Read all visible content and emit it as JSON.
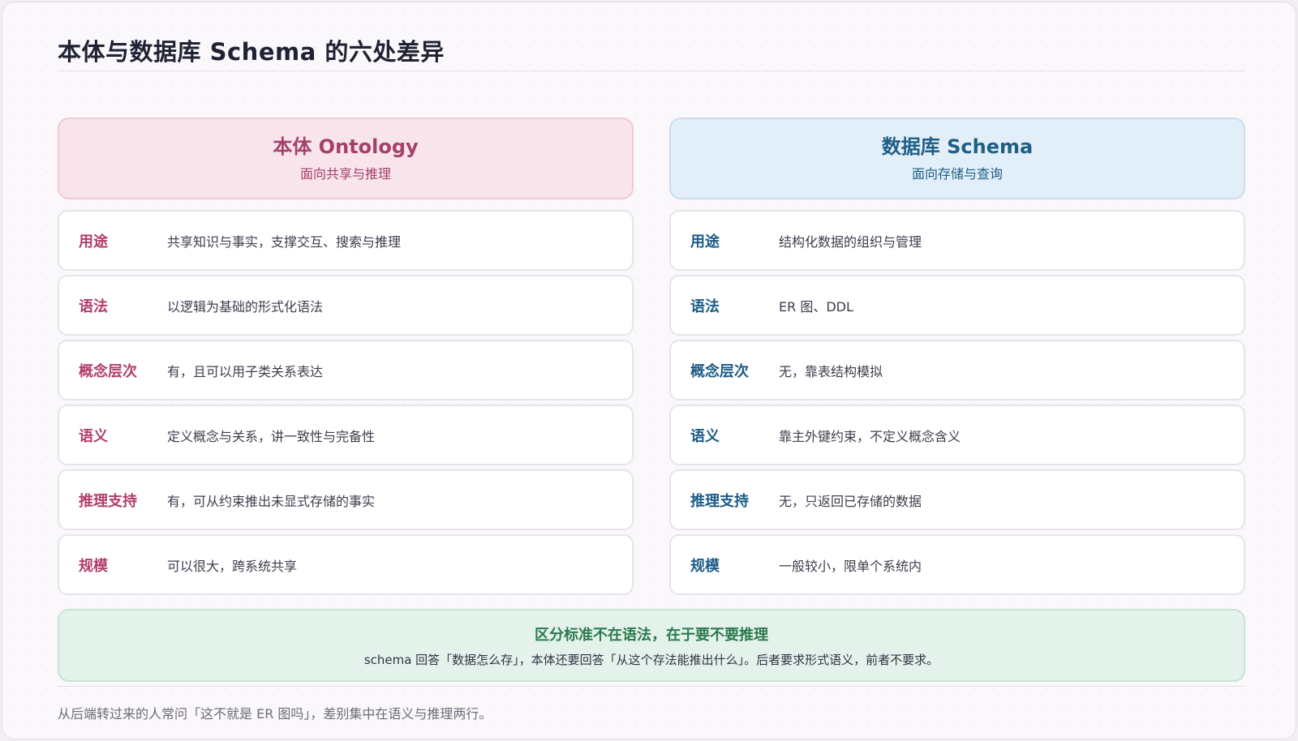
{
  "title": "本体与数据库 Schema 的六处差异",
  "columns": [
    {
      "header": "本体 Ontology",
      "subtitle": "面向共享与推理",
      "rows": [
        {
          "label": "用途",
          "text": "共享知识与事实，支撑交互、搜索与推理"
        },
        {
          "label": "语法",
          "text": "以逻辑为基础的形式化语法"
        },
        {
          "label": "概念层次",
          "text": "有，且可以用子类关系表达"
        },
        {
          "label": "语义",
          "text": "定义概念与关系，讲一致性与完备性"
        },
        {
          "label": "推理支持",
          "text": "有，可从约束推出未显式存储的事实"
        },
        {
          "label": "规模",
          "text": "可以很大，跨系统共享"
        }
      ]
    },
    {
      "header": "数据库 Schema",
      "subtitle": "面向存储与查询",
      "rows": [
        {
          "label": "用途",
          "text": "结构化数据的组织与管理"
        },
        {
          "label": "语法",
          "text": "ER 图、DDL"
        },
        {
          "label": "概念层次",
          "text": "无，靠表结构模拟"
        },
        {
          "label": "语义",
          "text": "靠主外键约束，不定义概念含义"
        },
        {
          "label": "推理支持",
          "text": "无，只返回已存储的数据"
        },
        {
          "label": "规模",
          "text": "一般较小，限单个系统内"
        }
      ]
    }
  ],
  "summary": {
    "title": "区分标准不在语法，在于要不要推理",
    "text": "schema 回答「数据怎么存」，本体还要回答「从这个存法能推出什么」。后者要求形式语义，前者不要求。"
  },
  "footnote": "从后端转过来的人常问「这不就是 ER 图吗」，差别集中在语义与推理两行。",
  "colors": {
    "ontology_accent": "#b23e6d",
    "schema_accent": "#1c5c86",
    "summary_accent": "#2c7a4e"
  }
}
